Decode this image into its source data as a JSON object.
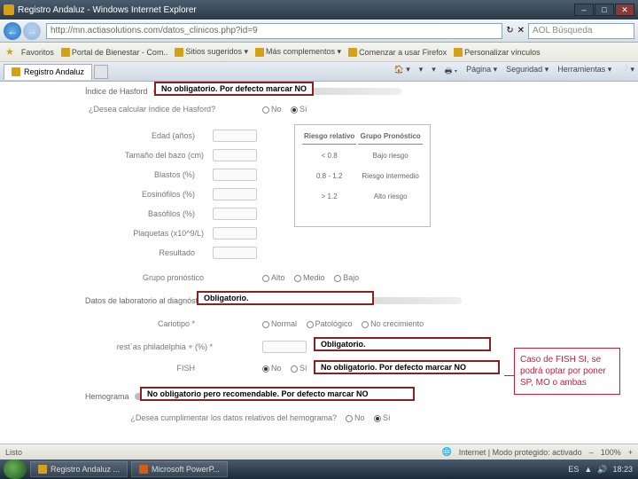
{
  "window": {
    "title": "Registro Andaluz - Windows Internet Explorer"
  },
  "nav": {
    "url": "http://mn.actiasolutions.com/datos_clinicos.php?id=9",
    "search_placeholder": "AOL Búsqueda"
  },
  "fav": {
    "label": "Favoritos",
    "links": [
      "Portal de Bienestar - Com..",
      "Sitios sugeridos ▾",
      "Más complementos ▾",
      "Comenzar a usar Firefox",
      "Personalizar vínculos"
    ]
  },
  "tab": {
    "title": "Registro Andaluz",
    "right": [
      "Página ▾",
      "Seguridad ▾",
      "Herramientas ▾"
    ]
  },
  "sections": {
    "hasford": "Índice de Hasford",
    "calc": "¿Desea calcular índice de Hasford?",
    "grupo": "Grupo pronóstico",
    "datoslab": "Datos de laboratorio al diagnóstico",
    "hemograma": "Hemograma",
    "hemo_q": "¿Desea cumplimentar los datos relativos del hemograma?"
  },
  "notes": {
    "n1": "No obligatorio. Por defecto marcar NO",
    "n2": "Obligatorio.",
    "n3": "Obligatorio.",
    "n4": "No obligatorio. Por defecto marcar NO",
    "n5": "No obligatorio pero recomendable. Por defecto marcar NO"
  },
  "fields": {
    "f1": "Edad (años)",
    "f2": "Tamaño del bazo (cm)",
    "f3": "Blastos (%)",
    "f4": "Eosinófilos (%)",
    "f5": "Basófilos (%)",
    "f6": "Plaquetas (x10^9/L)",
    "f7": "Resultado",
    "cariotipo": "Cariotipo *",
    "cphil": "rest`as philadelphia + (%) *",
    "fish": "FISH"
  },
  "radios": {
    "no": "No",
    "si": "Sí",
    "alto": "Alto",
    "medio": "Medio",
    "bajo": "Bajo",
    "normal": "Normal",
    "patologico": "Patológico",
    "noc": "No crecimiento"
  },
  "risk": {
    "h1": "Riesgo relativo",
    "h2": "Grupo Pronóstico",
    "r1a": "< 0.8",
    "r1b": "Bajo riesgo",
    "r2a": "0.8 - 1.2",
    "r2b": "Riesgo intermedio",
    "r3a": "> 1.2",
    "r3b": "Alto riesgo"
  },
  "callout": "Caso de FISH SI, se podrá optar por poner SP, MO o ambas",
  "status": {
    "left": "Listo",
    "right": "Internet | Modo protegido: activado",
    "zoom": "100%"
  },
  "taskbar": {
    "b1": "Registro Andaluz ...",
    "b2": "Microsoft PowerP...",
    "lang": "ES",
    "time": "18:23"
  }
}
